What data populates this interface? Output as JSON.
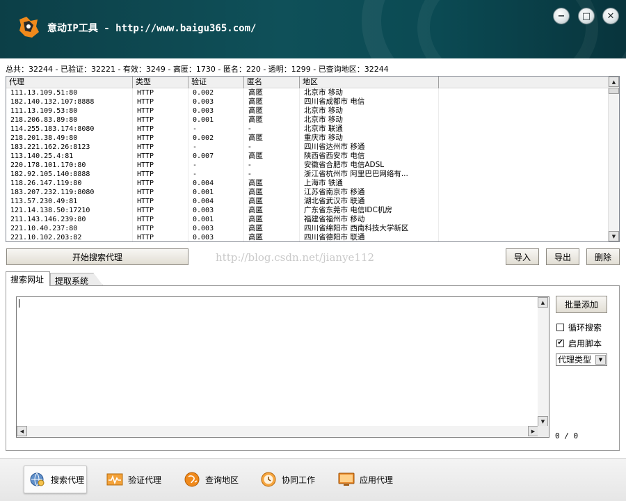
{
  "window": {
    "title": "意动IP工具 - http://www.baigu365.com/",
    "buttons": {
      "minimize": "−",
      "maximize": "□",
      "close": "✕"
    }
  },
  "stats": "总共：32244 - 已验证：32221 - 有效：3249 - 高匿：1730 - 匿名：220 - 透明：1299 - 已查询地区：32244",
  "table": {
    "headers": [
      "代理",
      "类型",
      "验证",
      "匿名",
      "地区",
      ""
    ],
    "rows": [
      [
        "111.13.109.51:80",
        "HTTP",
        "0.002",
        "高匿",
        "北京市 移动"
      ],
      [
        "182.140.132.107:8888",
        "HTTP",
        "0.003",
        "高匿",
        "四川省成都市 电信"
      ],
      [
        "111.13.109.53:80",
        "HTTP",
        "0.003",
        "高匿",
        "北京市 移动"
      ],
      [
        "218.206.83.89:80",
        "HTTP",
        "0.001",
        "高匿",
        "北京市 移动"
      ],
      [
        "114.255.183.174:8080",
        "HTTP",
        "-",
        "-",
        "北京市 联通"
      ],
      [
        "218.201.38.49:80",
        "HTTP",
        "0.002",
        "高匿",
        "重庆市 移动"
      ],
      [
        "183.221.162.26:8123",
        "HTTP",
        "-",
        "-",
        "四川省达州市 移通"
      ],
      [
        "113.140.25.4:81",
        "HTTP",
        "0.007",
        "高匿",
        "陕西省西安市 电信"
      ],
      [
        "220.178.101.170:80",
        "HTTP",
        "-",
        "-",
        "安徽省合肥市 电信ADSL"
      ],
      [
        "182.92.105.140:8888",
        "HTTP",
        "-",
        "-",
        "浙江省杭州市 阿里巴巴网络有..."
      ],
      [
        "118.26.147.119:80",
        "HTTP",
        "0.004",
        "高匿",
        "上海市 铁通"
      ],
      [
        "183.207.232.119:8080",
        "HTTP",
        "0.001",
        "高匿",
        "江苏省南京市 移通"
      ],
      [
        "113.57.230.49:81",
        "HTTP",
        "0.004",
        "高匿",
        "湖北省武汉市 联通"
      ],
      [
        "121.14.138.50:17210",
        "HTTP",
        "0.003",
        "高匿",
        "广东省东莞市 电信IDC机房"
      ],
      [
        "211.143.146.239:80",
        "HTTP",
        "0.001",
        "高匿",
        "福建省福州市 移动"
      ],
      [
        "221.10.40.237:80",
        "HTTP",
        "0.003",
        "高匿",
        "四川省绵阳市 西南科技大学新区"
      ],
      [
        "221.10.102.203:82",
        "HTTP",
        "0.003",
        "高匿",
        "四川省德阳市 联通"
      ]
    ]
  },
  "actions": {
    "start_search": "开始搜索代理",
    "import": "导入",
    "export": "导出",
    "delete": "删除"
  },
  "watermark": "http://blog.csdn.net/jianye112",
  "tabs": [
    "搜索网址",
    "提取系统"
  ],
  "panel": {
    "textarea_value": "",
    "batch_add": "批量添加",
    "loop_search": {
      "label": "循环搜索",
      "checked": false
    },
    "enable_script": {
      "label": "启用脚本",
      "checked": true
    },
    "proxy_type_select": "代理类型",
    "counter": "0 / 0"
  },
  "toolbar": [
    {
      "label": "搜索代理",
      "icon": "globe-search-icon",
      "active": true
    },
    {
      "label": "验证代理",
      "icon": "pulse-monitor-icon",
      "active": false
    },
    {
      "label": "查询地区",
      "icon": "location-globe-icon",
      "active": false
    },
    {
      "label": "协同工作",
      "icon": "clock-gear-icon",
      "active": false
    },
    {
      "label": "应用代理",
      "icon": "monitor-icon",
      "active": false
    }
  ],
  "colors": {
    "titlebar": "#0f5059",
    "accent_orange": "#f08a1c"
  }
}
